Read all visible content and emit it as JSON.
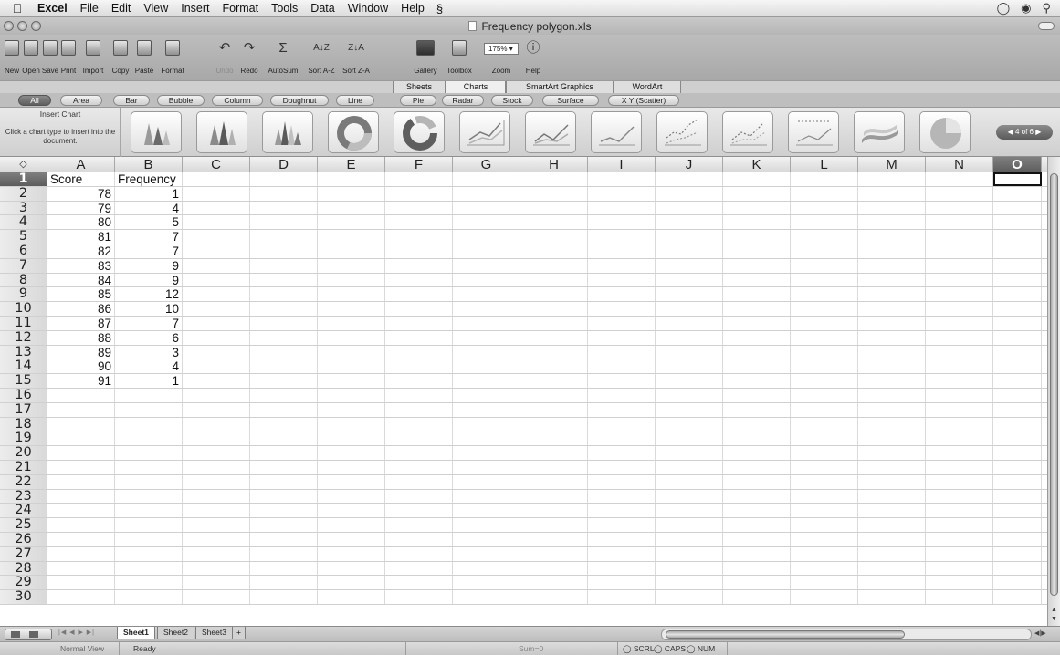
{
  "menubar": {
    "app": "Excel",
    "items": [
      "File",
      "Edit",
      "View",
      "Insert",
      "Format",
      "Tools",
      "Data",
      "Window",
      "Help"
    ],
    "script_icon": "script-menu-icon"
  },
  "window": {
    "title": "Frequency polygon.xls"
  },
  "toolbar": {
    "buttons": [
      {
        "label": "New",
        "name": "new-button"
      },
      {
        "label": "Open",
        "name": "open-button"
      },
      {
        "label": "Save",
        "name": "save-button"
      },
      {
        "label": "Print",
        "name": "print-button"
      },
      {
        "label": "Import",
        "name": "import-button"
      },
      {
        "label": "Copy",
        "name": "copy-button"
      },
      {
        "label": "Paste",
        "name": "paste-button"
      },
      {
        "label": "Format",
        "name": "format-button"
      },
      {
        "label": "Undo",
        "name": "undo-button"
      },
      {
        "label": "Redo",
        "name": "redo-button"
      },
      {
        "label": "AutoSum",
        "name": "autosum-button"
      },
      {
        "label": "Sort A-Z",
        "name": "sort-a-z-button"
      },
      {
        "label": "Sort Z-A",
        "name": "sort-z-a-button"
      },
      {
        "label": "Gallery",
        "name": "gallery-button"
      },
      {
        "label": "Toolbox",
        "name": "toolbox-button"
      },
      {
        "label": "Zoom",
        "name": "zoom-button"
      },
      {
        "label": "Help",
        "name": "help-button"
      }
    ],
    "zoom_value": "175%"
  },
  "ribbon_tabs": [
    "Sheets",
    "Charts",
    "SmartArt Graphics",
    "WordArt"
  ],
  "ribbon_active": "Charts",
  "chart_types": [
    "All",
    "Area",
    "Bar",
    "Bubble",
    "Column",
    "Doughnut",
    "Line",
    "Pie",
    "Radar",
    "Stock",
    "Surface",
    "X Y (Scatter)"
  ],
  "chart_types_selected": "All",
  "gallery": {
    "title": "Insert Chart",
    "hint": "Click a chart type to insert into the document.",
    "pager": "4 of 6"
  },
  "grid": {
    "columns": [
      "A",
      "B",
      "C",
      "D",
      "E",
      "F",
      "G",
      "H",
      "I",
      "J",
      "K",
      "L",
      "M",
      "N",
      "O"
    ],
    "selected_column": "O",
    "corner_symbol": "◇",
    "row_count": 30,
    "selected_row": 1,
    "headers": [
      "Score",
      "Frequency"
    ],
    "data": [
      [
        "78",
        "1"
      ],
      [
        "79",
        "4"
      ],
      [
        "80",
        "5"
      ],
      [
        "81",
        "7"
      ],
      [
        "82",
        "7"
      ],
      [
        "83",
        "9"
      ],
      [
        "84",
        "9"
      ],
      [
        "85",
        "12"
      ],
      [
        "86",
        "10"
      ],
      [
        "87",
        "7"
      ],
      [
        "88",
        "6"
      ],
      [
        "89",
        "3"
      ],
      [
        "90",
        "4"
      ],
      [
        "91",
        "1"
      ]
    ]
  },
  "sheets": [
    "Sheet1",
    "Sheet2",
    "Sheet3"
  ],
  "active_sheet": "Sheet1",
  "add_sheet": "+",
  "status": {
    "view": "Normal View",
    "ready": "Ready",
    "sum": "Sum=0",
    "scrl": "SCRL",
    "caps": "CAPS",
    "num": "NUM"
  }
}
